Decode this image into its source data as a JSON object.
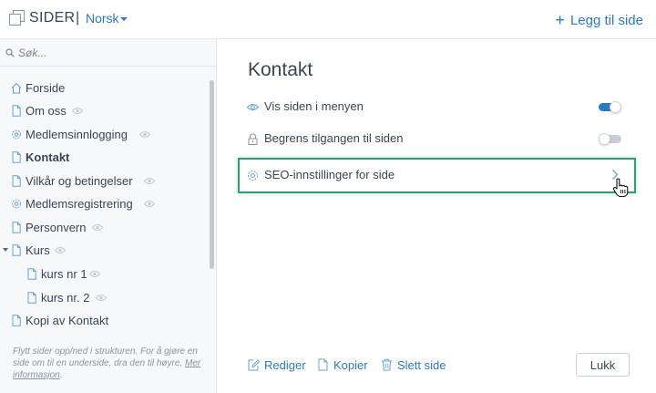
{
  "header": {
    "app_title": "SIDER",
    "separator": "|",
    "language": "Norsk",
    "add_page_label": "Legg til side"
  },
  "sidebar": {
    "search_placeholder": "Søk...",
    "items": [
      {
        "label": "Forside",
        "icon": "home-icon",
        "hidden": false,
        "active": false
      },
      {
        "label": "Om oss",
        "icon": "page-icon",
        "hidden": true,
        "active": false
      },
      {
        "label": "Medlemsinnlogging",
        "icon": "gear-icon",
        "hidden": true,
        "active": false
      },
      {
        "label": "Kontakt",
        "icon": "page-icon",
        "hidden": false,
        "active": true
      },
      {
        "label": "Vilkår og betingelser",
        "icon": "page-icon",
        "hidden": true,
        "active": false
      },
      {
        "label": "Medlemsregistrering",
        "icon": "gear-icon",
        "hidden": true,
        "active": false
      },
      {
        "label": "Personvern",
        "icon": "page-icon",
        "hidden": true,
        "active": false
      },
      {
        "label": "Kurs",
        "icon": "page-icon",
        "hidden": true,
        "active": false,
        "expanded": true
      },
      {
        "label": "kurs nr 1",
        "icon": "page-icon",
        "hidden": true,
        "active": false
      },
      {
        "label": "kurs nr. 2",
        "icon": "page-icon",
        "hidden": true,
        "active": false
      },
      {
        "label": "Kopi av Kontakt",
        "icon": "page-icon",
        "hidden": false,
        "active": false
      }
    ],
    "help_text": "Flytt sider opp/ned i strukturen. For å gjøre en side om til en underside, dra den til høyre.",
    "help_link": "Mer informasjon",
    "help_end": "."
  },
  "main": {
    "page_title": "Kontakt",
    "show_in_menu_label": "Vis siden i menyen",
    "show_in_menu_on": true,
    "restrict_access_label": "Begrens tilgangen til siden",
    "restrict_access_on": false,
    "seo_label": "SEO-innstillinger for side",
    "actions": {
      "edit_label": "Rediger",
      "copy_label": "Kopier",
      "delete_label": "Slett side"
    },
    "close_label": "Lukk"
  },
  "colors": {
    "accent": "#2b7bc4",
    "highlight": "#2a9f78",
    "text": "#3a4654"
  }
}
